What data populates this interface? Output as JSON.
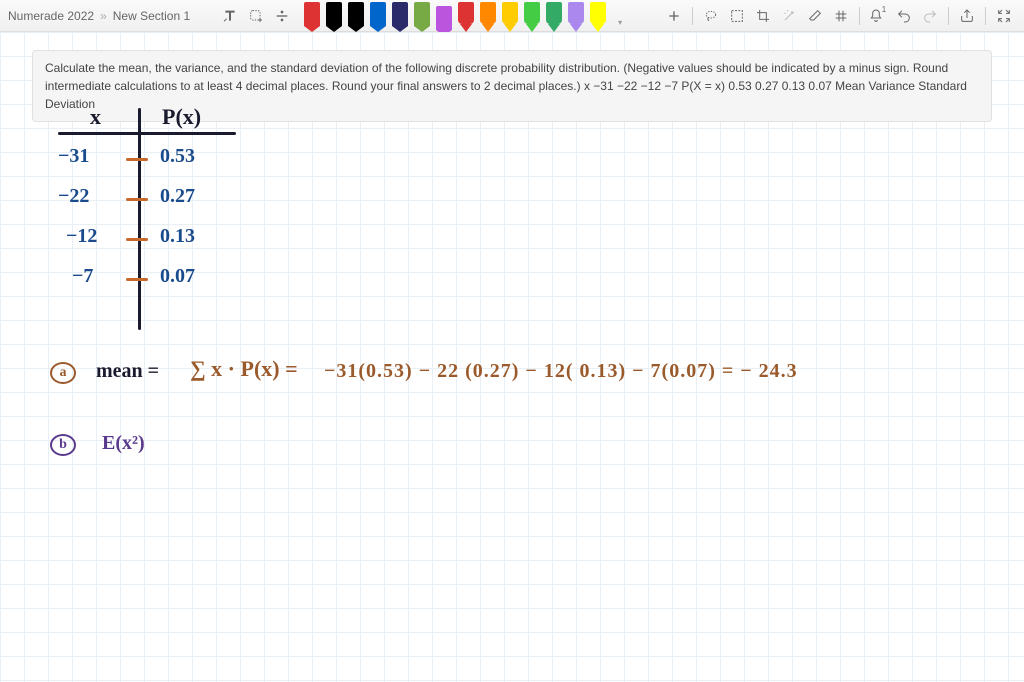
{
  "breadcrumb": {
    "app": "Numerade 2022",
    "section": "New Section 1"
  },
  "pens": [
    {
      "color": "#d33",
      "type": "pen"
    },
    {
      "color": "#000",
      "type": "pen"
    },
    {
      "color": "#000",
      "type": "pen"
    },
    {
      "color": "#06c",
      "type": "pen"
    },
    {
      "color": "#2a2a6a",
      "type": "pen"
    },
    {
      "color": "#7a4",
      "type": "pen"
    },
    {
      "color": "#b5d",
      "type": "pen",
      "selected": true
    },
    {
      "color": "#d33",
      "type": "hl"
    },
    {
      "color": "#f80",
      "type": "hl"
    },
    {
      "color": "#fc0",
      "type": "hl"
    },
    {
      "color": "#4c4",
      "type": "hl"
    },
    {
      "color": "#3a6",
      "type": "hl"
    },
    {
      "color": "#a8e",
      "type": "hl"
    },
    {
      "color": "#ff0",
      "type": "hl"
    }
  ],
  "question": "Calculate the mean, the variance, and the standard deviation of the following discrete probability distribution. (Negative values should be indicated by a minus sign. Round intermediate calculations to at least 4 decimal places. Round your final answers to 2 decimal places.) x −31 −22 −12 −7 P(X = x) 0.53 0.27 0.13 0.07 Mean Variance Standard Deviation",
  "table": {
    "header_x": "x",
    "header_px": "P(x)",
    "rows": [
      {
        "x": "−31",
        "px": "0.53"
      },
      {
        "x": "−22",
        "px": "0.27"
      },
      {
        "x": "−12",
        "px": "0.13"
      },
      {
        "x": "−7",
        "px": "0.07"
      }
    ]
  },
  "work": {
    "a_label": "a",
    "a_lhs": "mean =",
    "a_sum": "∑ x · P(x) =",
    "a_expr": "−31(0.53) − 22 (0.27)  − 12( 0.13) − 7(0.07) = − 24.3",
    "b_label": "b",
    "b_expr": "E(x²)"
  }
}
